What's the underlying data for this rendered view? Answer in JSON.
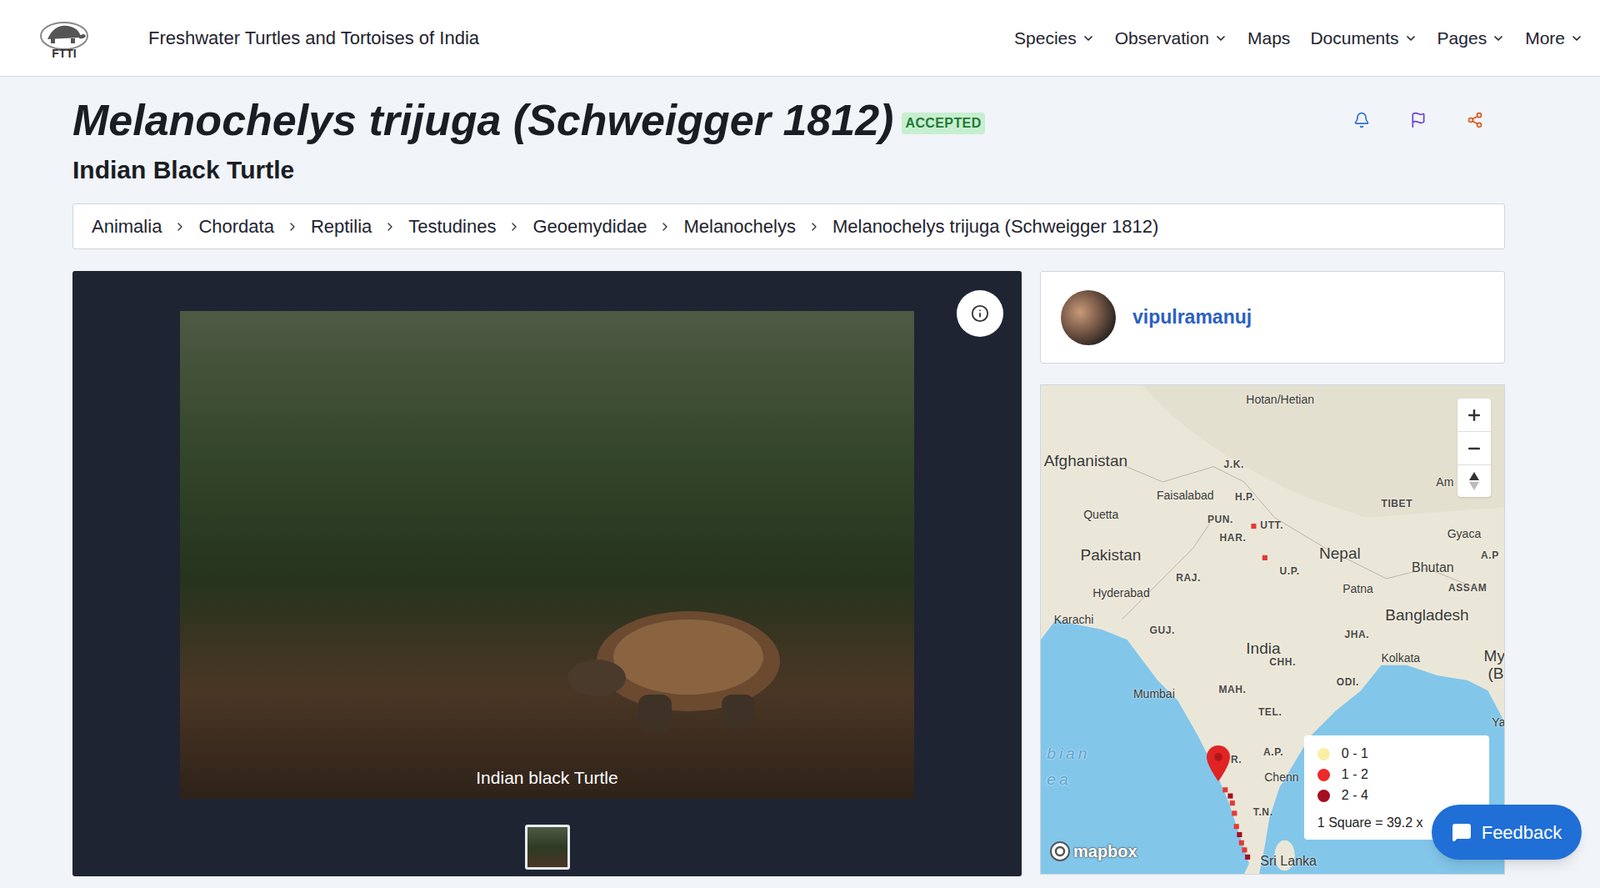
{
  "header": {
    "logo_text": "FTTI",
    "site_title": "Freshwater Turtles and Tortoises of India",
    "nav": [
      {
        "label": "Species",
        "dropdown": true
      },
      {
        "label": "Observation",
        "dropdown": true
      },
      {
        "label": "Maps",
        "dropdown": false
      },
      {
        "label": "Documents",
        "dropdown": true
      },
      {
        "label": "Pages",
        "dropdown": true
      },
      {
        "label": "More",
        "dropdown": true
      }
    ]
  },
  "species": {
    "name": "Melanochelys trijuga (Schweigger 1812)",
    "status": "ACCEPTED",
    "common_name": "Indian Black Turtle"
  },
  "breadcrumb": [
    "Animalia",
    "Chordata",
    "Reptilia",
    "Testudines",
    "Geoemydidae",
    "Melanochelys",
    "Melanochelys trijuga (Schweigger 1812)"
  ],
  "gallery": {
    "caption": "Indian black Turtle",
    "thumbnails": [
      {
        "selected": true
      }
    ]
  },
  "contributor": {
    "username": "vipulramanuj"
  },
  "map": {
    "labels": [
      {
        "text": "Hotan/Hetian",
        "kind": "city"
      },
      {
        "text": "Afghanistan",
        "kind": "country"
      },
      {
        "text": "J.K.",
        "kind": "state"
      },
      {
        "text": "Faisalabad",
        "kind": "city"
      },
      {
        "text": "H.P.",
        "kind": "state"
      },
      {
        "text": "Am",
        "kind": "city"
      },
      {
        "text": "TIBET",
        "kind": "state"
      },
      {
        "text": "Quetta",
        "kind": "city"
      },
      {
        "text": "PUN.",
        "kind": "state"
      },
      {
        "text": "UTT.",
        "kind": "state"
      },
      {
        "text": "Gyaca",
        "kind": "city"
      },
      {
        "text": "HAR.",
        "kind": "state"
      },
      {
        "text": "Pakistan",
        "kind": "country"
      },
      {
        "text": "Nepal",
        "kind": "country"
      },
      {
        "text": "A.P",
        "kind": "state"
      },
      {
        "text": "U.P.",
        "kind": "state"
      },
      {
        "text": "Bhutan",
        "kind": "minor"
      },
      {
        "text": "RAJ.",
        "kind": "state"
      },
      {
        "text": "ASSAM",
        "kind": "state"
      },
      {
        "text": "Patna",
        "kind": "city"
      },
      {
        "text": "Hyderabad",
        "kind": "city"
      },
      {
        "text": "Bangladesh",
        "kind": "country"
      },
      {
        "text": "Karachi",
        "kind": "city"
      },
      {
        "text": "GUJ.",
        "kind": "state"
      },
      {
        "text": "JHA.",
        "kind": "state"
      },
      {
        "text": "India",
        "kind": "country"
      },
      {
        "text": "Kolkata",
        "kind": "city"
      },
      {
        "text": "My",
        "kind": "country"
      },
      {
        "text": "(B",
        "kind": "country"
      },
      {
        "text": "CHH.",
        "kind": "state"
      },
      {
        "text": "ODI.",
        "kind": "state"
      },
      {
        "text": "MAH.",
        "kind": "state"
      },
      {
        "text": "Mumbai",
        "kind": "city"
      },
      {
        "text": "TEL.",
        "kind": "state"
      },
      {
        "text": "Ya",
        "kind": "city"
      },
      {
        "text": "bian",
        "kind": "water"
      },
      {
        "text": "ea",
        "kind": "water"
      },
      {
        "text": "A.P.",
        "kind": "state"
      },
      {
        "text": "R.",
        "kind": "state"
      },
      {
        "text": "Chenn",
        "kind": "city"
      },
      {
        "text": "T.N.",
        "kind": "state"
      },
      {
        "text": "Sri Lanka",
        "kind": "minor"
      }
    ],
    "legend": [
      {
        "label": "0 - 1",
        "color": "#fbefa5"
      },
      {
        "label": "1 - 2",
        "color": "#ec2a2a"
      },
      {
        "label": "2 - 4",
        "color": "#a30f1f"
      }
    ],
    "scale": "1 Square = 39.2 x",
    "attribution": "mapbox"
  },
  "feedback": {
    "label": "Feedback"
  }
}
